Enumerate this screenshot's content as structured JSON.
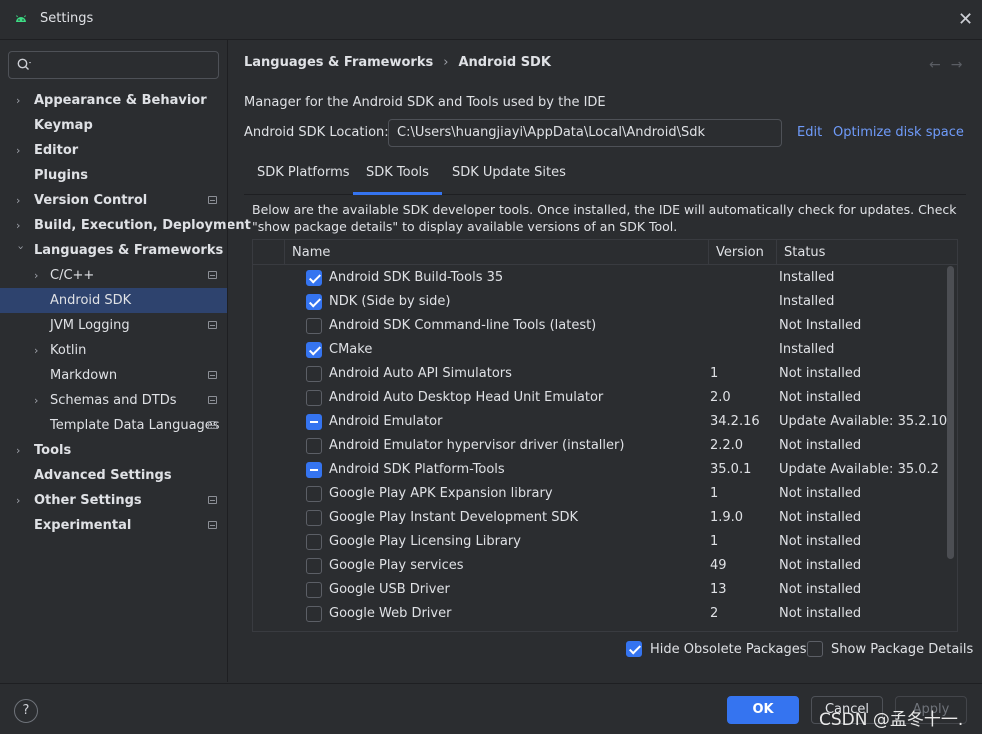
{
  "window": {
    "title": "Settings"
  },
  "search": {
    "placeholder": ""
  },
  "sidebar": {
    "items": [
      {
        "label": "Appearance & Behavior"
      },
      {
        "label": "Keymap"
      },
      {
        "label": "Editor"
      },
      {
        "label": "Plugins"
      },
      {
        "label": "Version Control"
      },
      {
        "label": "Build, Execution, Deployment"
      },
      {
        "label": "Languages & Frameworks"
      },
      {
        "label": "C/C++"
      },
      {
        "label": "Android SDK"
      },
      {
        "label": "JVM Logging"
      },
      {
        "label": "Kotlin"
      },
      {
        "label": "Markdown"
      },
      {
        "label": "Schemas and DTDs"
      },
      {
        "label": "Template Data Languages"
      },
      {
        "label": "Tools"
      },
      {
        "label": "Advanced Settings"
      },
      {
        "label": "Other Settings"
      },
      {
        "label": "Experimental"
      }
    ]
  },
  "breadcrumb": {
    "parent": "Languages & Frameworks",
    "separator": "›",
    "current": "Android SDK"
  },
  "nav": {
    "back": "←",
    "forward": "→"
  },
  "main": {
    "description": "Manager for the Android SDK and Tools used by the IDE",
    "sdk_location_label": "Android SDK Location:",
    "sdk_location_value": "C:\\Users\\huangjiayi\\AppData\\Local\\Android\\Sdk",
    "edit_link": "Edit",
    "optimize_link": "Optimize disk space",
    "tabs": [
      {
        "label": "SDK Platforms"
      },
      {
        "label": "SDK Tools"
      },
      {
        "label": "SDK Update Sites"
      }
    ],
    "tools_description": "Below are the available SDK developer tools. Once installed, the IDE will automatically check for updates. Check \"show package details\" to display available versions of an SDK Tool."
  },
  "table": {
    "headers": {
      "name": "Name",
      "version": "Version",
      "status": "Status"
    },
    "rows": [
      {
        "name": "Android SDK Build-Tools 35",
        "version": "",
        "status": "Installed",
        "state": "checked"
      },
      {
        "name": "NDK (Side by side)",
        "version": "",
        "status": "Installed",
        "state": "checked"
      },
      {
        "name": "Android SDK Command-line Tools (latest)",
        "version": "",
        "status": "Not Installed",
        "state": "unchecked"
      },
      {
        "name": "CMake",
        "version": "",
        "status": "Installed",
        "state": "checked"
      },
      {
        "name": "Android Auto API Simulators",
        "version": "1",
        "status": "Not installed",
        "state": "unchecked"
      },
      {
        "name": "Android Auto Desktop Head Unit Emulator",
        "version": "2.0",
        "status": "Not installed",
        "state": "unchecked"
      },
      {
        "name": "Android Emulator",
        "version": "34.2.16",
        "status": "Update Available: 35.2.10",
        "state": "partial"
      },
      {
        "name": "Android Emulator hypervisor driver (installer)",
        "version": "2.2.0",
        "status": "Not installed",
        "state": "unchecked"
      },
      {
        "name": "Android SDK Platform-Tools",
        "version": "35.0.1",
        "status": "Update Available: 35.0.2",
        "state": "partial"
      },
      {
        "name": "Google Play APK Expansion library",
        "version": "1",
        "status": "Not installed",
        "state": "unchecked"
      },
      {
        "name": "Google Play Instant Development SDK",
        "version": "1.9.0",
        "status": "Not installed",
        "state": "unchecked"
      },
      {
        "name": "Google Play Licensing Library",
        "version": "1",
        "status": "Not installed",
        "state": "unchecked"
      },
      {
        "name": "Google Play services",
        "version": "49",
        "status": "Not installed",
        "state": "unchecked"
      },
      {
        "name": "Google USB Driver",
        "version": "13",
        "status": "Not installed",
        "state": "unchecked"
      },
      {
        "name": "Google Web Driver",
        "version": "2",
        "status": "Not installed",
        "state": "unchecked"
      }
    ]
  },
  "options": {
    "hide_obsolete": {
      "label": "Hide Obsolete Packages",
      "checked": true
    },
    "show_details": {
      "label": "Show Package Details",
      "checked": false
    }
  },
  "footer": {
    "help": "?",
    "ok_label": "OK",
    "cancel_label": "Cancel",
    "apply_label": "Apply",
    "watermark": "CSDN @孟冬十一."
  },
  "colors": {
    "accent": "#3574f0",
    "link": "#6f9bfa",
    "selection": "#2e436e",
    "background": "#2b2d30"
  },
  "icons": {
    "app": "android-icon",
    "close": "close-icon",
    "search": "search-icon",
    "help": "help-icon"
  }
}
